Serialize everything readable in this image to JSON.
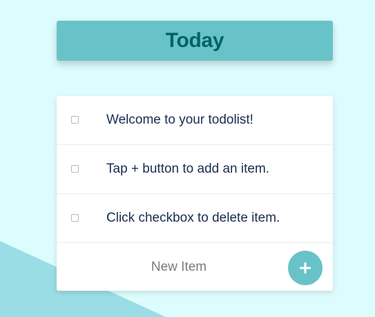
{
  "header": {
    "title": "Today"
  },
  "todos": [
    {
      "text": "Welcome to your todolist!",
      "checked": false
    },
    {
      "text": "Tap + button to add an item.",
      "checked": false
    },
    {
      "text": "Click checkbox to delete item.",
      "checked": false
    }
  ],
  "new_item": {
    "placeholder": "New Item",
    "value": ""
  },
  "add_button": {
    "icon": "plus-icon"
  },
  "colors": {
    "background": "#ddfcfd",
    "accent": "#68c3c9",
    "title_text": "#006464",
    "item_text": "#1a2d4f",
    "background_shape": "#9adde5"
  }
}
